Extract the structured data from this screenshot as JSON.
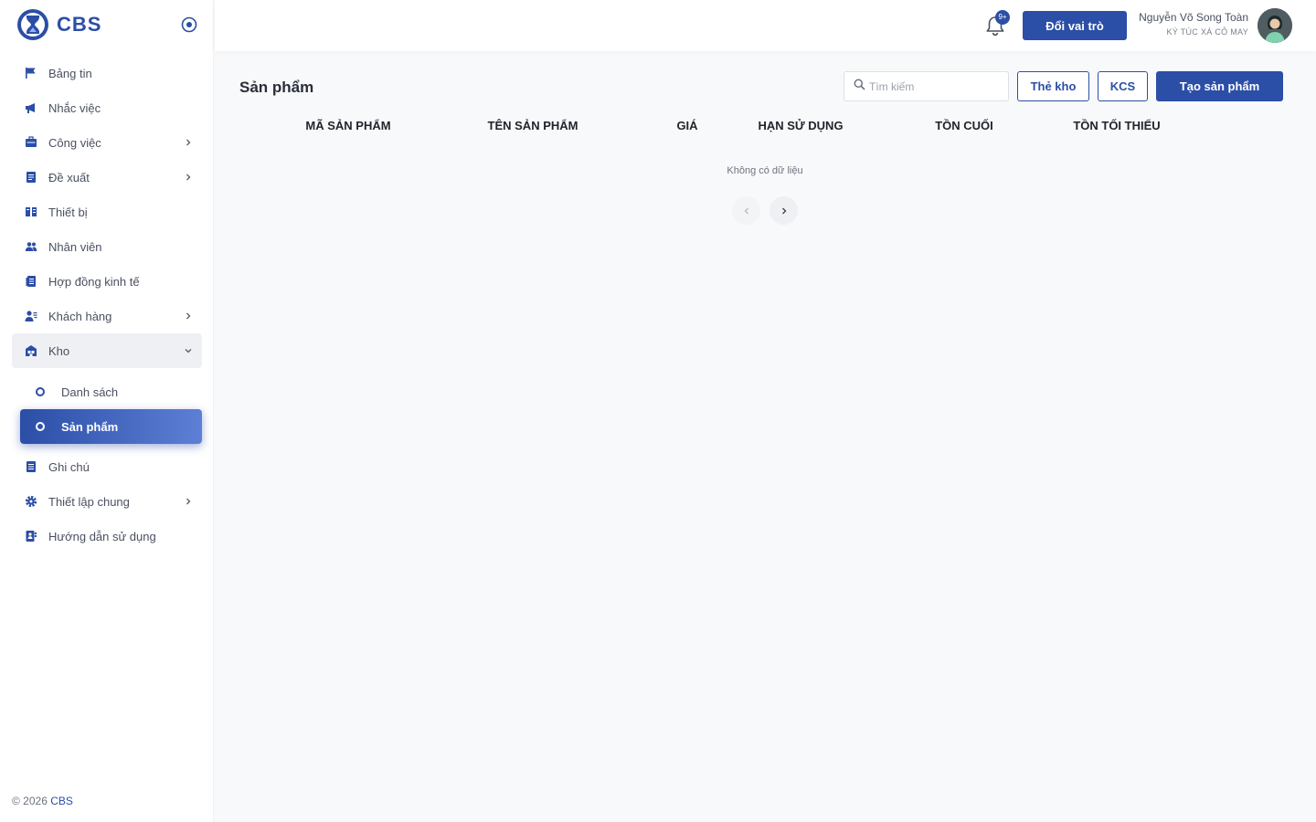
{
  "brand": {
    "name": "CBS"
  },
  "sidebar": {
    "items": [
      {
        "label": "Bảng tin",
        "icon": "flag-icon",
        "has_children": false
      },
      {
        "label": "Nhắc việc",
        "icon": "megaphone-icon",
        "has_children": false
      },
      {
        "label": "Công việc",
        "icon": "briefcase-icon",
        "has_children": true
      },
      {
        "label": "Đề xuất",
        "icon": "document-list-icon",
        "has_children": true
      },
      {
        "label": "Thiết bị",
        "icon": "devices-icon",
        "has_children": false
      },
      {
        "label": "Nhân viên",
        "icon": "people-icon",
        "has_children": false
      },
      {
        "label": "Hợp đồng kinh tế",
        "icon": "contract-icon",
        "has_children": false
      },
      {
        "label": "Khách hàng",
        "icon": "customer-icon",
        "has_children": true
      },
      {
        "label": "Kho",
        "icon": "warehouse-icon",
        "has_children": true,
        "expanded": true,
        "children": [
          {
            "label": "Danh sách",
            "active": false
          },
          {
            "label": "Sản phẩm",
            "active": true
          }
        ]
      },
      {
        "label": "Ghi chú",
        "icon": "note-icon",
        "has_children": false
      },
      {
        "label": "Thiết lập chung",
        "icon": "gear-icon",
        "has_children": true
      },
      {
        "label": "Hướng dẫn sử dụng",
        "icon": "guide-icon",
        "has_children": false
      }
    ],
    "footer": {
      "copyright": "© 2026 ",
      "brand": "CBS"
    }
  },
  "header": {
    "notification_badge": "9+",
    "switch_role_label": "Đổi vai trò",
    "user": {
      "name": "Nguyễn Võ Song Toàn",
      "org": "KÝ TÚC XÁ CỎ MAY"
    }
  },
  "main": {
    "title": "Sản phẩm",
    "search": {
      "placeholder": "Tìm kiếm",
      "value": ""
    },
    "buttons": {
      "stock_card": "Thẻ kho",
      "qc": "KCS",
      "create": "Tạo sản phẩm"
    },
    "table": {
      "columns": [
        "MÃ SẢN PHẨM",
        "TÊN SẢN PHẨM",
        "GIÁ",
        "HẠN SỬ DỤNG",
        "TỒN CUỐI",
        "TỒN TỐI THIỂU"
      ],
      "rows": [],
      "empty_text": "Không có dữ liệu"
    }
  },
  "colors": {
    "primary": "#2b4ea6",
    "active_gradient_end": "#5d7fd6",
    "background": "#f8f9fa"
  }
}
